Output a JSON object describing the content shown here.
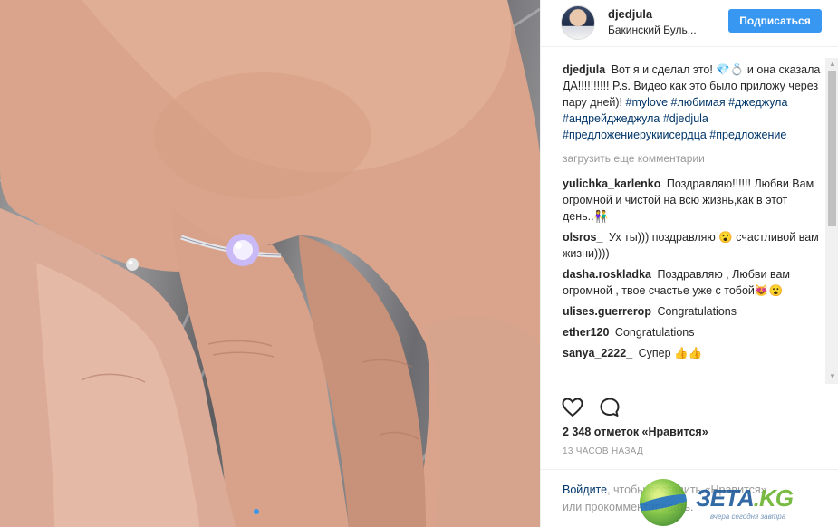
{
  "post": {
    "author": "djedjula",
    "location": "Бакинский Буль...",
    "follow_label": "Подписаться",
    "caption": {
      "username": "djedjula",
      "text": "Вот я и сделал это! 💎💍 и она сказала ДА!!!!!!!!!! P.s. Видео как это было приложу через пару дней)!",
      "hashtags": [
        "#mylove",
        "#любимая",
        "#джеджула",
        "#андрейджеджула",
        "#djedjula",
        "#предложениерукиисердца",
        "#предложение"
      ]
    },
    "load_more": "загрузить еще комментарии",
    "comments": [
      {
        "user": "yulichka_karlenko",
        "text": "Поздравляю!!!!!! Любви Вам огромной и чистой на всю жизнь,как в этот день..👫"
      },
      {
        "user": "olsros_",
        "text": "Ух ты))) поздравляю 😮 счастливой вам жизни))))"
      },
      {
        "user": "dasha.roskladka",
        "text": "Поздравляю , Любви вам огромной , твое счастье уже с тобой😻😮"
      },
      {
        "user": "ulises.guerrerop",
        "text": "Congratulations"
      },
      {
        "user": "ether120",
        "text": "Congratulations"
      },
      {
        "user": "sanya_2222_",
        "text": "Супер 👍👍"
      }
    ],
    "likes": "2 348 отметок «Нравится»",
    "time": "13 ЧАСОВ НАЗАД",
    "login_prefix": "Войдите",
    "login_mid": ", чтобы поставить «Нравится»",
    "login_line2": "или прокомментировать."
  },
  "icons": {
    "like": "heart-icon",
    "comment": "comment-bubble-icon"
  },
  "watermark": {
    "brand": "ЗЕТА",
    "suffix": ".KG",
    "tagline": "вчера сегодня завтра"
  },
  "colors": {
    "accent": "#3897f0",
    "hashtag": "#003569",
    "muted": "#999999",
    "text": "#262626"
  }
}
